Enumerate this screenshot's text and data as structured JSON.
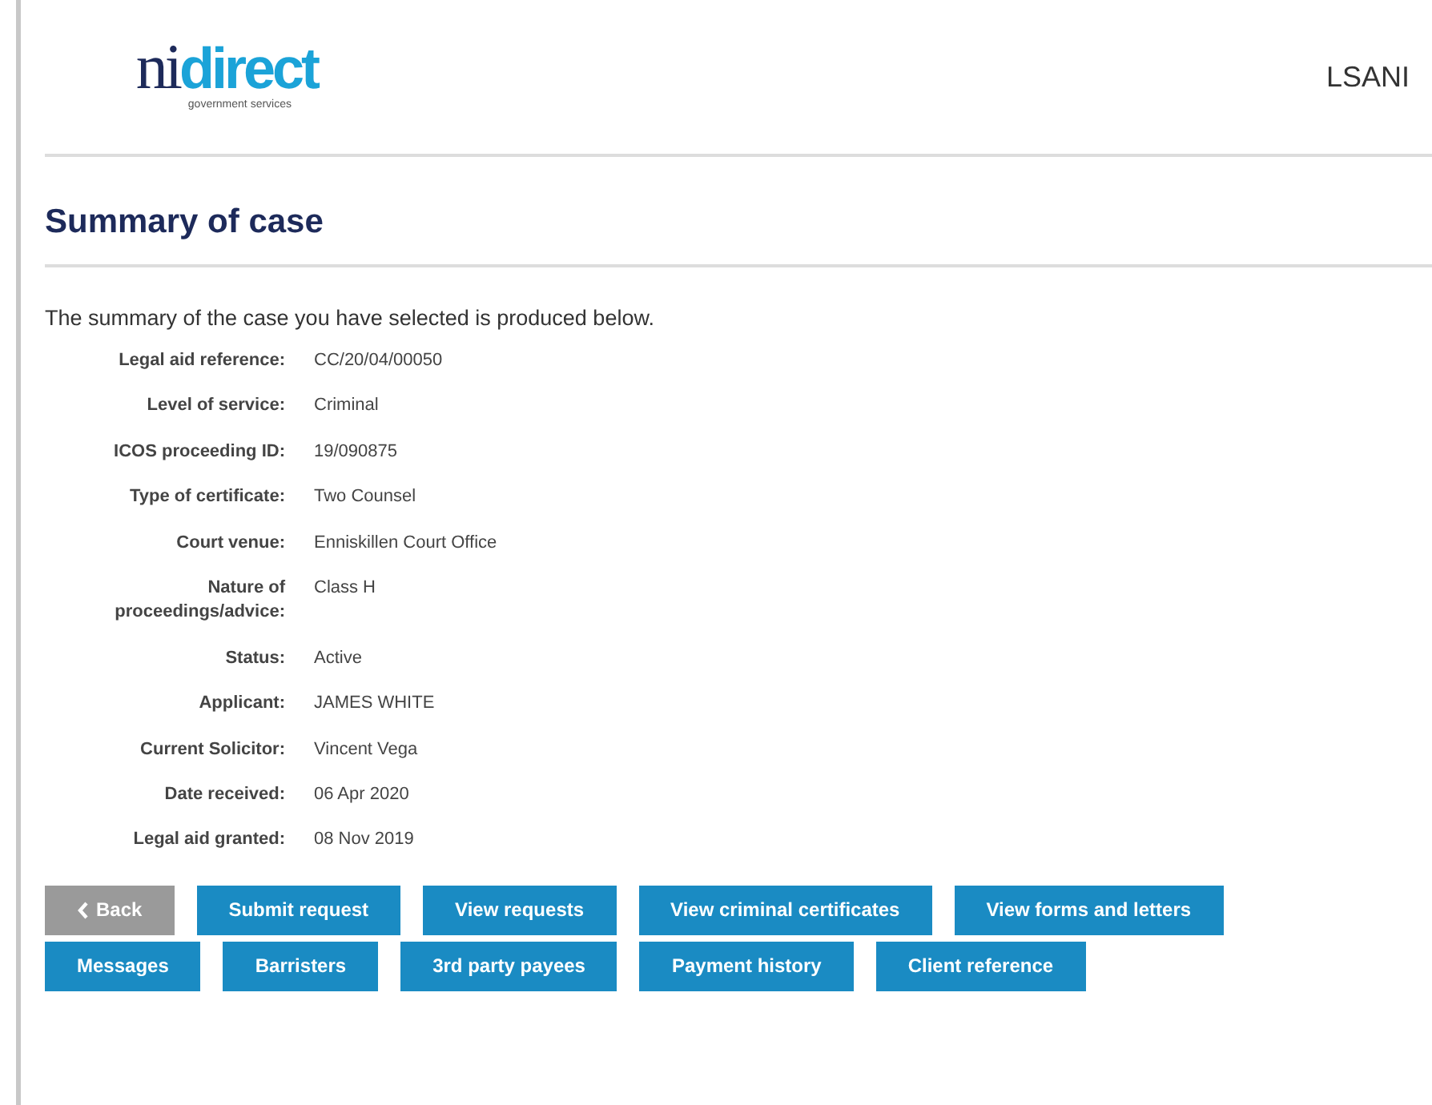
{
  "header": {
    "logo": {
      "part_1": "ni",
      "part_2": "direct",
      "tagline": "government services"
    },
    "site": "LSANI"
  },
  "title": "Summary of case",
  "intro": "The summary of the case you have selected is produced below.",
  "details": [
    {
      "label": "Legal aid reference:",
      "value": "CC/20/04/00050"
    },
    {
      "label": "Level of service:",
      "value": "Criminal"
    },
    {
      "label": "ICOS proceeding ID:",
      "value": "19/090875"
    },
    {
      "label": "Type of certificate:",
      "value": "Two Counsel"
    },
    {
      "label": "Court venue:",
      "value": "Enniskillen Court Office"
    },
    {
      "label": "Nature of proceedings/advice:",
      "value": "Class H"
    },
    {
      "label": "Status:",
      "value": "Active"
    },
    {
      "label": "Applicant:",
      "value": "JAMES WHITE"
    },
    {
      "label": "Current Solicitor:",
      "value": "Vincent Vega"
    },
    {
      "label": "Date received:",
      "value": "06 Apr 2020"
    },
    {
      "label": "Legal aid granted:",
      "value": "08 Nov 2019"
    }
  ],
  "button_rows": [
    [
      {
        "label": "Back",
        "kind": "back",
        "disabled": true
      },
      {
        "label": "Submit request",
        "kind": "plain",
        "disabled": false
      },
      {
        "label": "View requests",
        "kind": "plain",
        "disabled": false
      },
      {
        "label": "View criminal certificates",
        "kind": "plain",
        "disabled": false
      },
      {
        "label": "View forms and letters",
        "kind": "plain",
        "disabled": false
      }
    ],
    [
      {
        "label": "Messages",
        "kind": "plain",
        "disabled": false
      },
      {
        "label": "Barristers",
        "kind": "plain",
        "disabled": false
      },
      {
        "label": "3rd party payees",
        "kind": "plain",
        "disabled": false
      },
      {
        "label": "Payment history",
        "kind": "plain",
        "disabled": false
      },
      {
        "label": "Client reference",
        "kind": "plain",
        "disabled": false
      }
    ]
  ]
}
